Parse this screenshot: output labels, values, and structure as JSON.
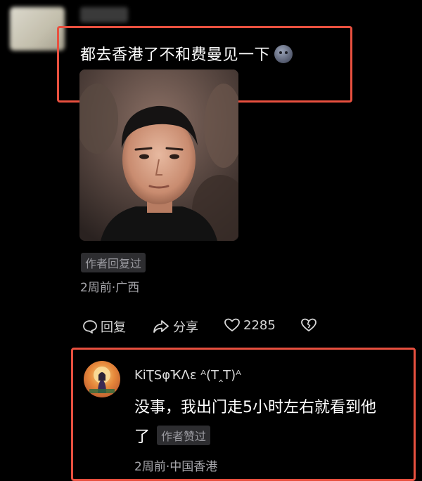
{
  "comment": {
    "text": "都去香港了不和费曼见一下",
    "sticker_icon": "smiley-sticker-icon",
    "author_badge": "作者回复过",
    "meta": "2周前·广西"
  },
  "actions": {
    "reply_label": "回复",
    "share_label": "分享",
    "like_count": "2285"
  },
  "reply": {
    "username": "KiƮSφҠΛε ᴬ(T‸T)ᴬ",
    "text": "没事，我出门走5小时左右就看到他",
    "text_tail": "了",
    "author_badge": "作者赞过",
    "meta": "2周前·中国香港"
  },
  "colors": {
    "highlight": "#e8503f",
    "background": "#000000",
    "badge_bg": "#2d2d30"
  }
}
